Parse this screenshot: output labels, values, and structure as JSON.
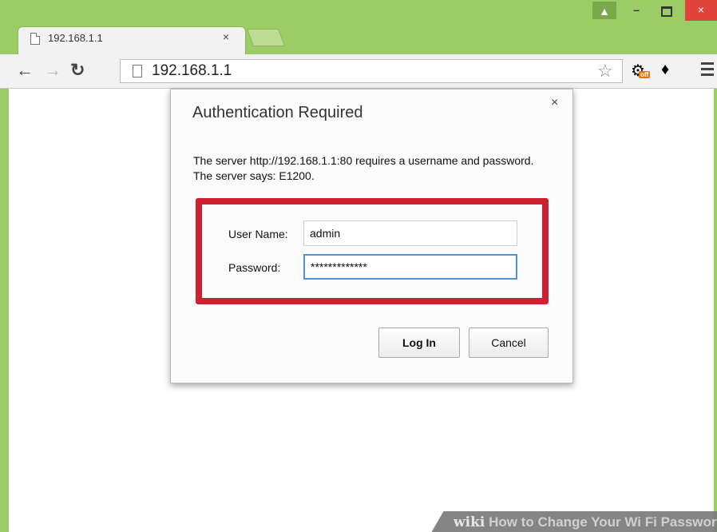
{
  "browser": {
    "tab": {
      "title": "192.168.1.1",
      "close_glyph": "×"
    },
    "address": {
      "url": "192.168.1.1"
    },
    "window_controls": {
      "close_glyph": "×",
      "minimize_glyph": "–"
    },
    "extensions": {
      "badge": "off"
    },
    "theme_color": "#9ccc65"
  },
  "dialog": {
    "title": "Authentication Required",
    "close_glyph": "×",
    "message": "The server http://192.168.1.1:80 requires a username and password. The server says: E1200.",
    "username_label": "User Name:",
    "username_value": "admin",
    "password_label": "Password:",
    "password_value": "*************",
    "login_label": "Log In",
    "cancel_label": "Cancel",
    "highlight_color": "#cf2030"
  },
  "watermark": {
    "brand": "wiki",
    "text": "How to Change Your Wi Fi Password"
  }
}
